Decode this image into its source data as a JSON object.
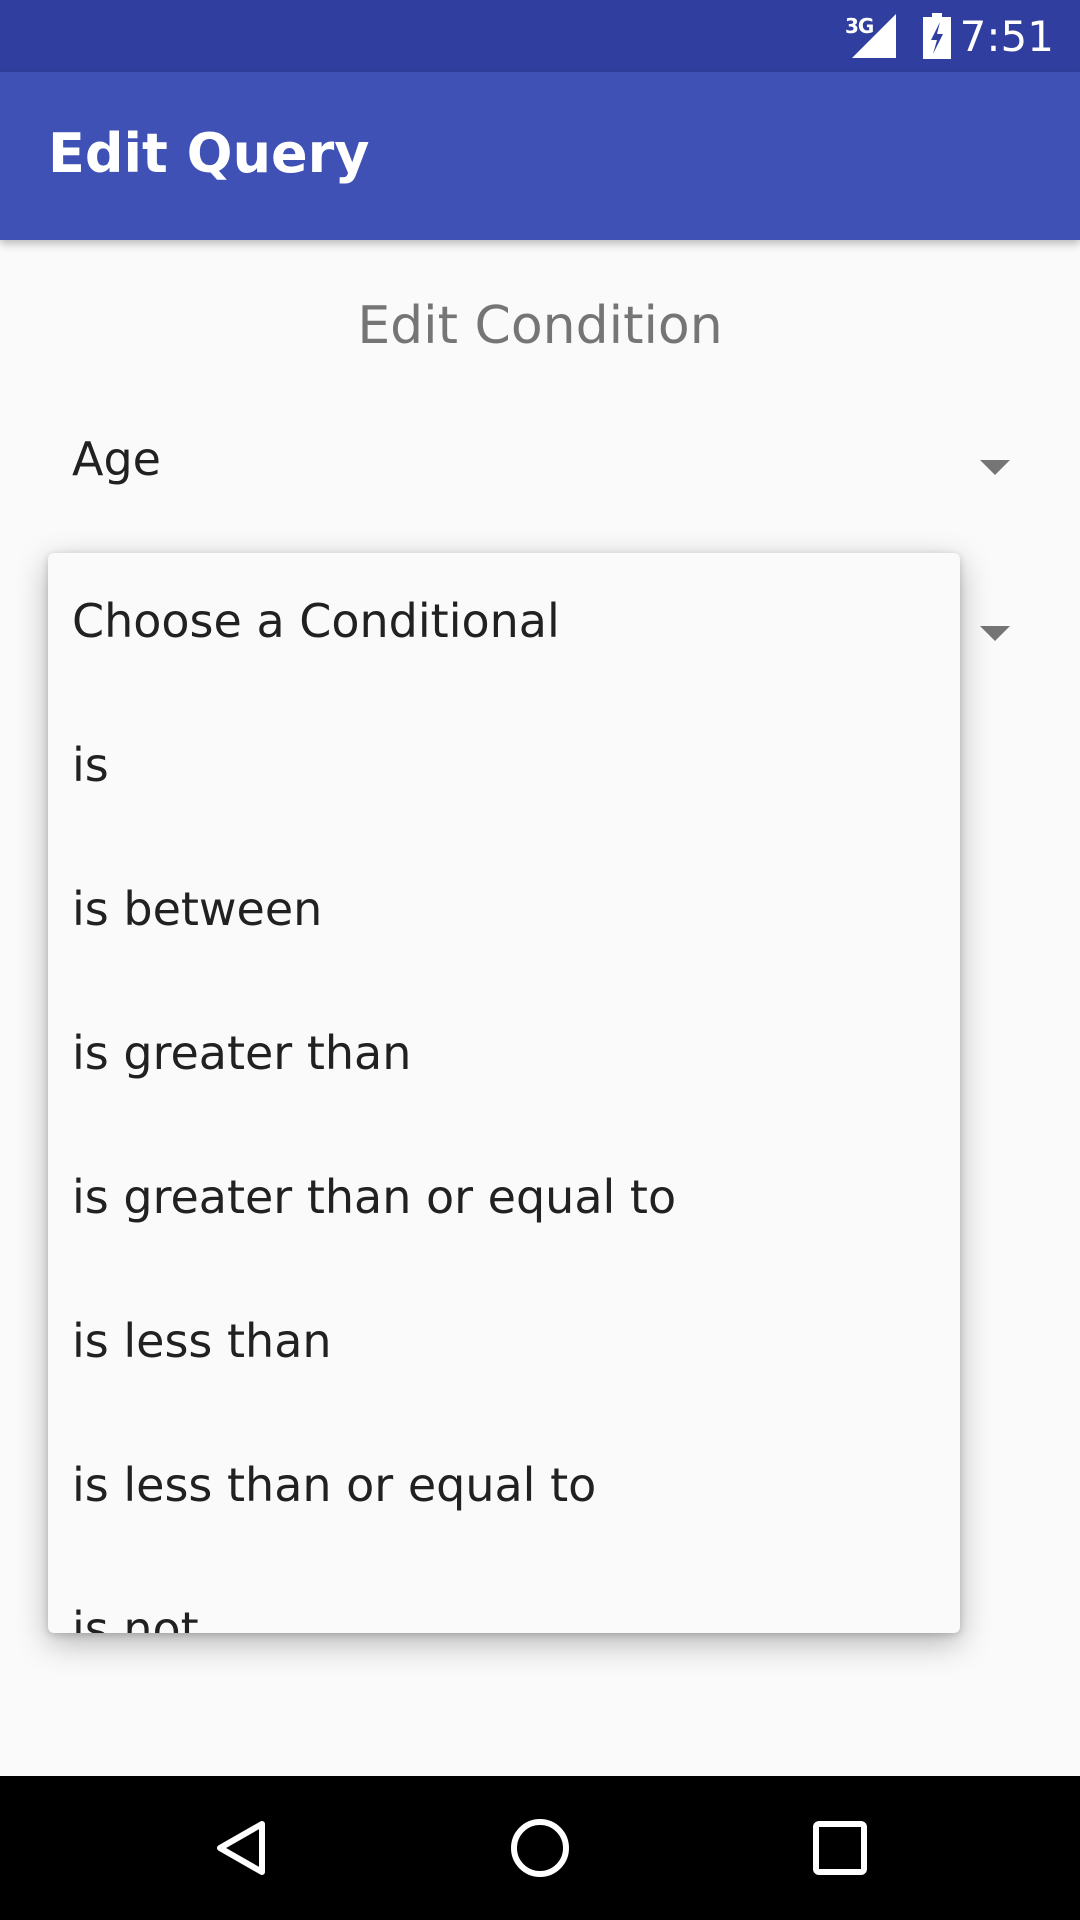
{
  "status_bar": {
    "network_label": "3G",
    "time": "7:51",
    "icons": [
      "signal-icon",
      "battery-charging-icon"
    ]
  },
  "app_bar": {
    "title": "Edit Query"
  },
  "main": {
    "section_title": "Edit Condition",
    "field_spinner": {
      "value": "Age"
    }
  },
  "dropdown": {
    "options": [
      "Choose a Conditional",
      "is",
      "is between",
      "is greater than",
      "is greater than or equal to",
      "is less than",
      "is less than or equal to",
      "is not"
    ]
  },
  "nav_bar": {
    "icons": [
      "back-icon",
      "home-icon",
      "recents-icon"
    ]
  },
  "colors": {
    "status_bar": "#303f9f",
    "app_bar": "#3f51b5",
    "background": "#fafafa"
  }
}
